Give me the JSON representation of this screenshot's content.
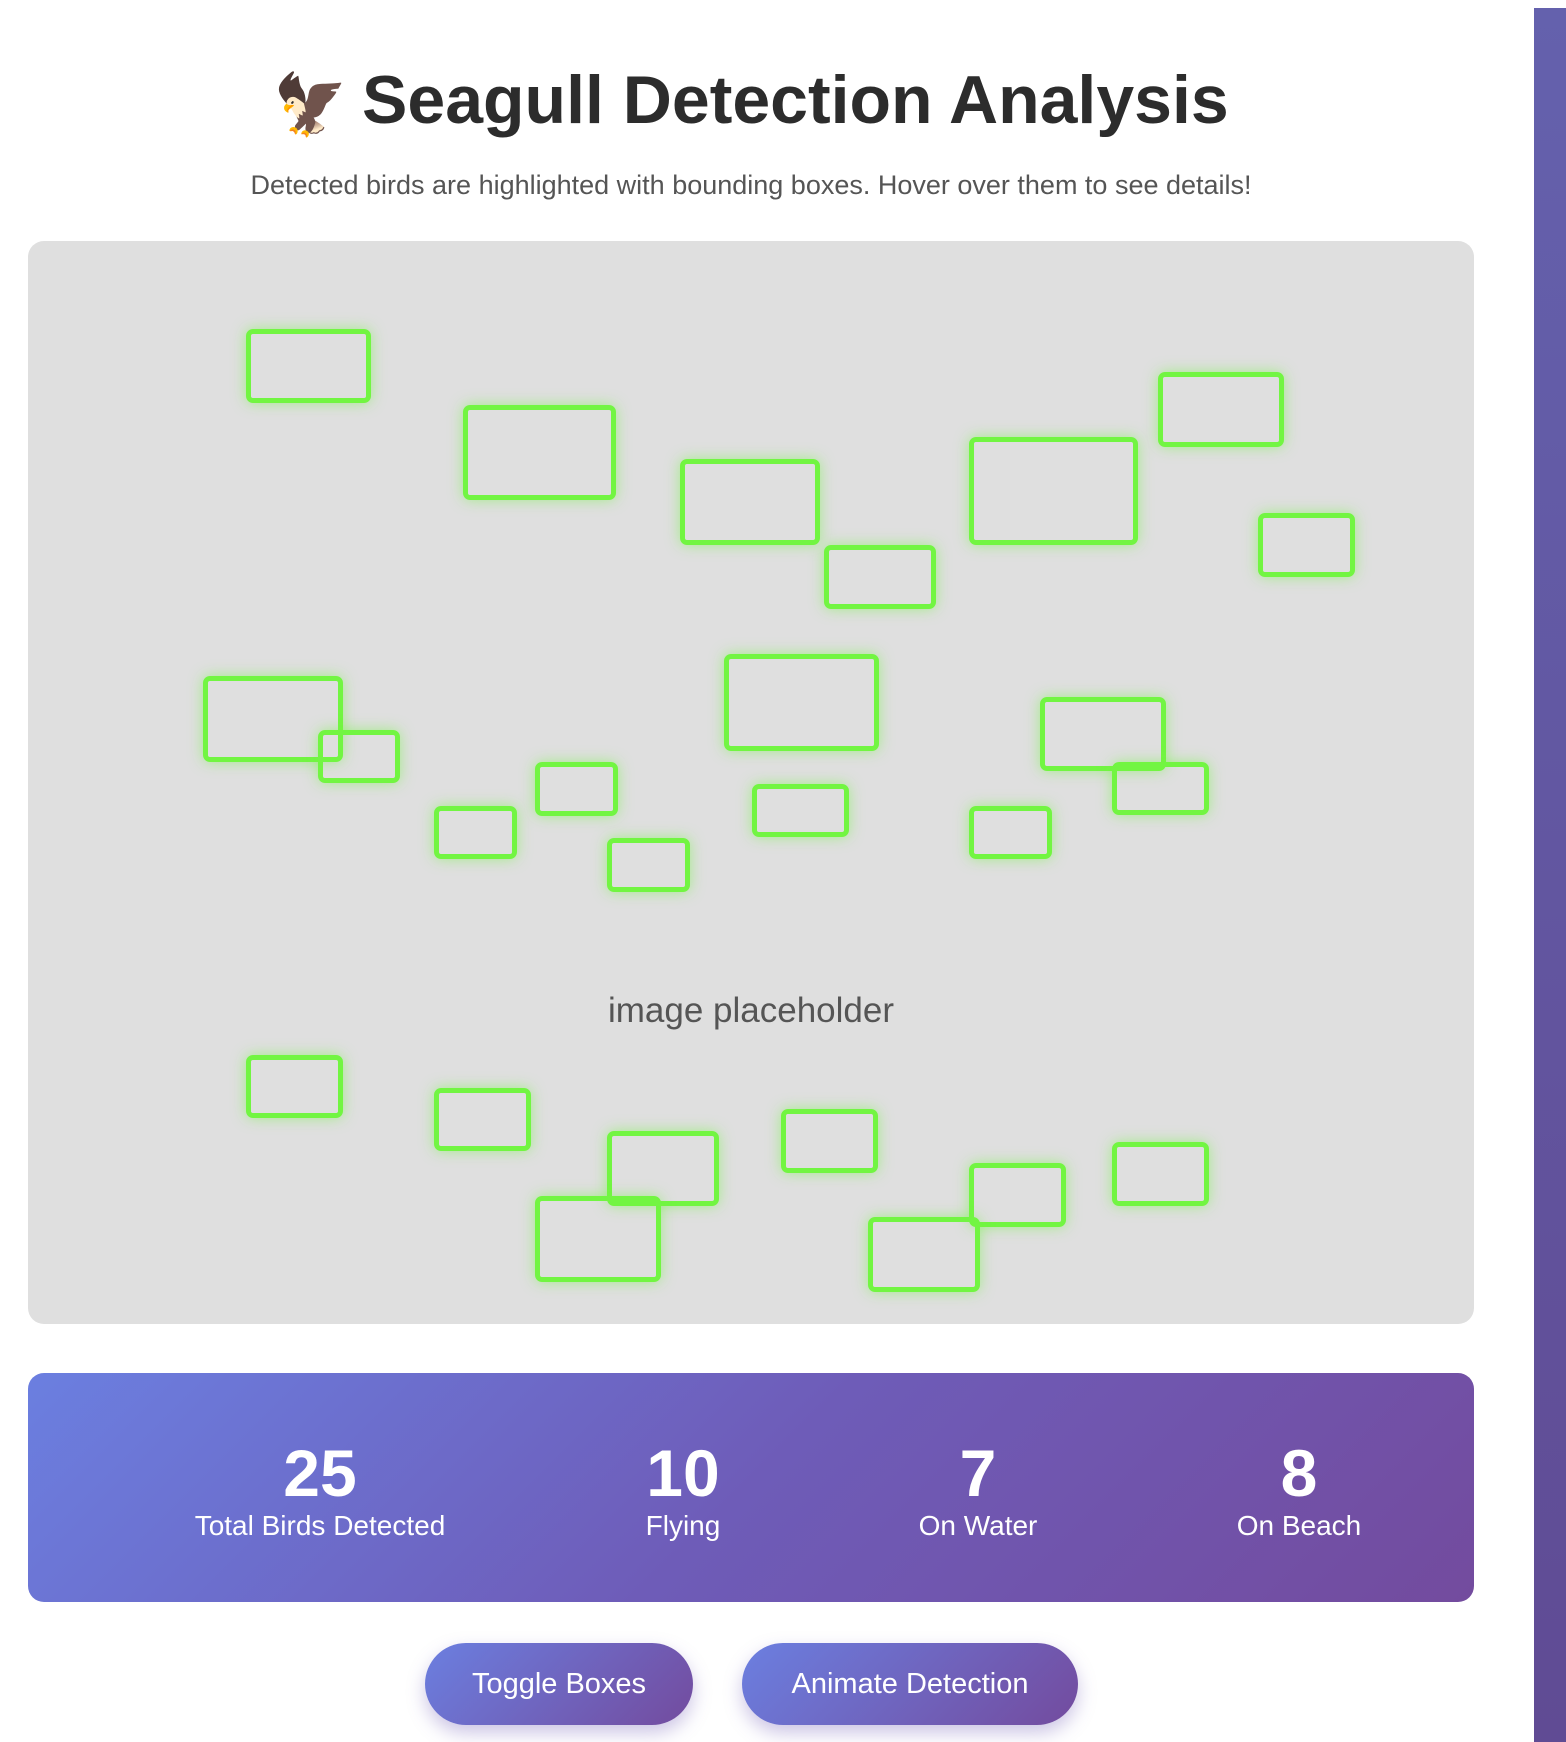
{
  "header": {
    "title_icon": "🦅",
    "title": "Seagull Detection Analysis",
    "subtitle": "Detected birds are highlighted with bounding boxes. Hover over them to see details!"
  },
  "image": {
    "placeholder_text": "image placeholder"
  },
  "stats": [
    {
      "value": "25",
      "label": "Total Birds Detected"
    },
    {
      "value": "10",
      "label": "Flying"
    },
    {
      "value": "7",
      "label": "On Water"
    },
    {
      "value": "8",
      "label": "On Beach"
    }
  ],
  "buttons": {
    "toggle_label": "Toggle Boxes",
    "animate_label": "Animate Detection"
  },
  "colors": {
    "bbox": "#72f542",
    "accent_start": "#6b7fe0",
    "accent_end": "#734b9e"
  }
}
